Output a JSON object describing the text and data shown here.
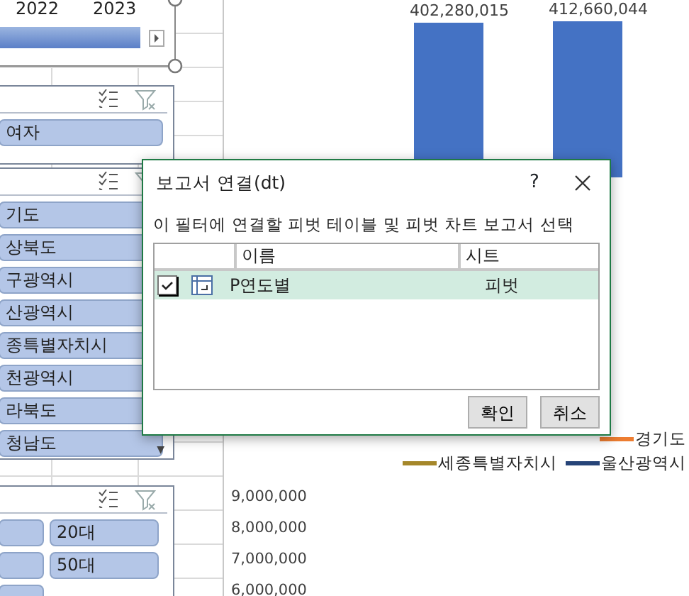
{
  "timeline": {
    "years": [
      "2022",
      "2023"
    ],
    "level": 1
  },
  "slicers": [
    {
      "items": [
        {
          "label": "여자",
          "selected": true
        }
      ]
    },
    {
      "scroll_down": "▼",
      "items": [
        {
          "label": "기도",
          "selected": true
        },
        {
          "label": "상북도",
          "selected": true
        },
        {
          "label": "구광역시",
          "selected": true
        },
        {
          "label": "산광역시",
          "selected": true
        },
        {
          "label": "종특별자치시",
          "selected": true
        },
        {
          "label": "천광역시",
          "selected": true
        },
        {
          "label": "라북도",
          "selected": true
        },
        {
          "label": "청남도",
          "selected": true
        }
      ]
    },
    {
      "items": [
        {
          "kind": "clipped",
          "selected": true
        },
        {
          "kind": "text",
          "label": "20대",
          "selected": true
        },
        {
          "kind": "clipped",
          "selected": true
        },
        {
          "kind": "text",
          "label": "50대",
          "selected": true
        },
        {
          "kind": "clipped",
          "selected": true
        }
      ]
    }
  ],
  "chart": {
    "data_labels": [
      "402,280,015",
      "412,660,044"
    ],
    "legend": [
      {
        "label": "경기도",
        "color": "#ed7d31"
      },
      {
        "label": "세종특별자치시",
        "color": "#a5872a"
      },
      {
        "label": "울산광역시",
        "color": "#264478"
      }
    ],
    "y_axis_labels": [
      "9,000,000",
      "8,000,000",
      "7,000,000",
      "6,000,000"
    ]
  },
  "dialog": {
    "title": "보고서 연결(dt)",
    "help": "?",
    "instruction": "이 필터에 연결할 피벗 테이블 및 피벗 차트 보고서 선택",
    "columns": [
      "이름",
      "시트"
    ],
    "rows": [
      {
        "checked": true,
        "selected": true,
        "name": "P연도별",
        "sheet": "피벗"
      }
    ],
    "buttons": [
      "확인",
      "취소"
    ]
  }
}
